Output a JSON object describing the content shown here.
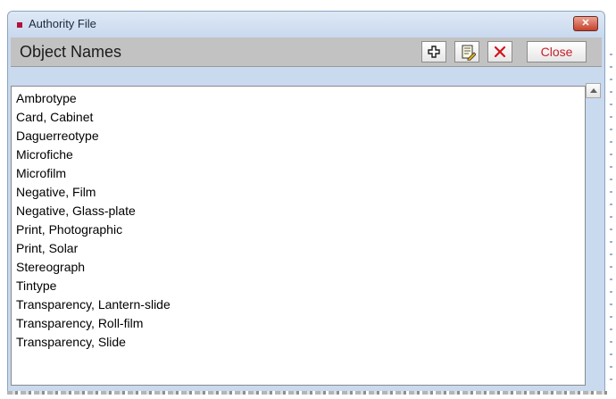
{
  "window": {
    "title": "Authority File",
    "close_glyph": "✕"
  },
  "header": {
    "title": "Object Names",
    "toolbar": [
      {
        "name": "add-icon",
        "tooltip": "Add"
      },
      {
        "name": "edit-icon",
        "tooltip": "Edit"
      },
      {
        "name": "delete-icon",
        "tooltip": "Delete"
      }
    ],
    "close_label": "Close"
  },
  "list": {
    "items": [
      "Ambrotype",
      "Card, Cabinet",
      "Daguerreotype",
      "Microfiche",
      "Microfilm",
      "Negative, Film",
      "Negative, Glass-plate",
      "Print, Photographic",
      "Print, Solar",
      "Stereograph",
      "Tintype",
      "Transparency, Lantern-slide",
      "Transparency, Roll-film",
      "Transparency, Slide"
    ]
  },
  "colors": {
    "title_accent": "#b0123a",
    "close_label": "#c81e2a",
    "delete_icon": "#d0141c"
  }
}
